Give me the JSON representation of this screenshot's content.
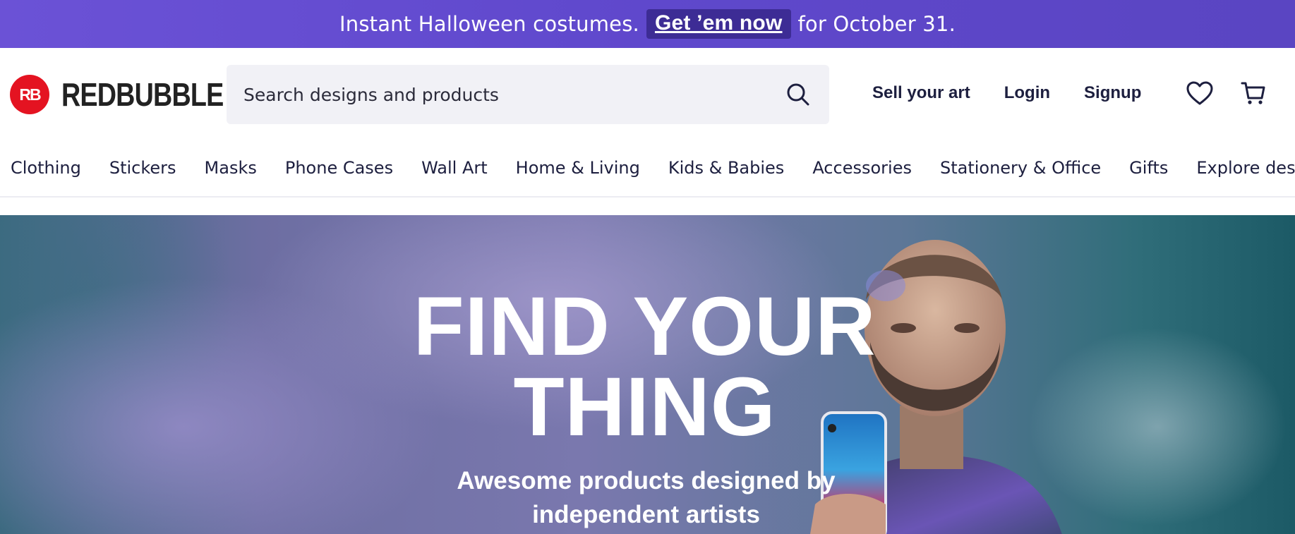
{
  "promo": {
    "prefix": "Instant Halloween costumes.",
    "cta": "Get ’em now",
    "suffix": "for October 31."
  },
  "header": {
    "logo_mark": "RB",
    "logo_text": "REDBUBBLE",
    "search_placeholder": "Search designs and products",
    "links": {
      "sell": "Sell your art",
      "login": "Login",
      "signup": "Signup"
    },
    "icons": [
      "search-icon",
      "heart-icon",
      "cart-icon"
    ]
  },
  "nav": {
    "categories": [
      "Clothing",
      "Stickers",
      "Masks",
      "Phone Cases",
      "Wall Art",
      "Home & Living",
      "Kids & Babies",
      "Accessories",
      "Stationery & Office",
      "Gifts",
      "Explore designs"
    ]
  },
  "hero": {
    "title_line1": "FIND YOUR",
    "title_line2": "THING",
    "subtitle_line1": "Awesome products designed by",
    "subtitle_line2": "independent artists"
  },
  "colors": {
    "promo_bg": "#6b52d6",
    "cta_bg": "#3d2c95",
    "brand_red": "#e41321",
    "text_dark": "#1d1f3f",
    "search_bg": "#f1f1f6"
  }
}
